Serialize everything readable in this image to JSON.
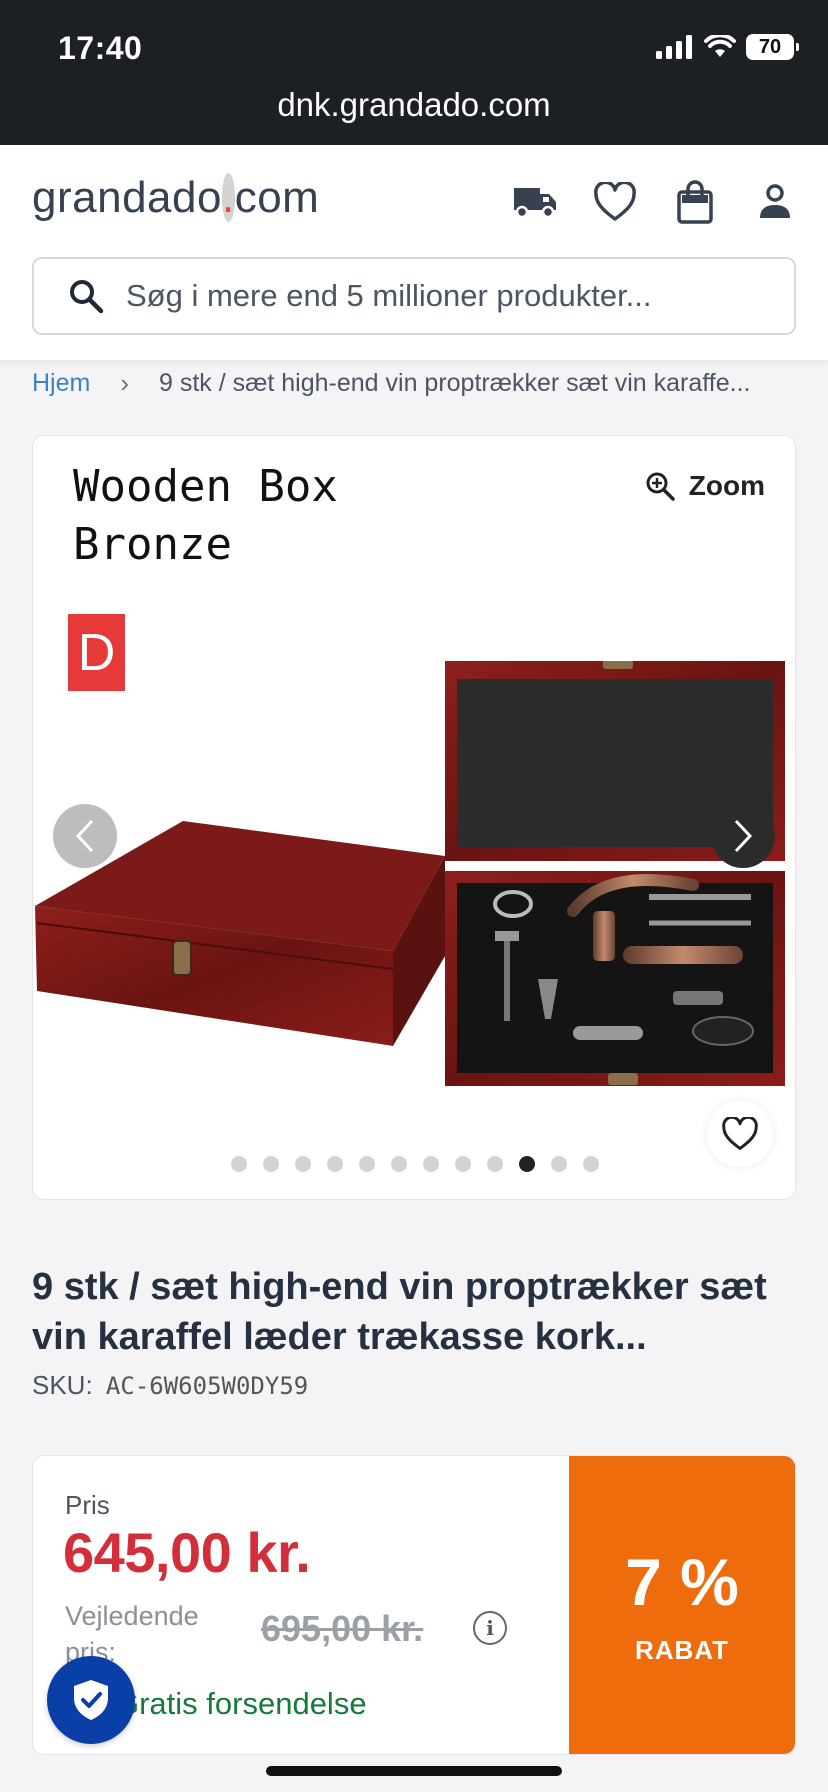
{
  "status_bar": {
    "time": "17:40",
    "battery": "70",
    "url": "dnk.grandado.com"
  },
  "header": {
    "logo_part1": "grandado",
    "logo_dot": ".",
    "logo_part2": "com",
    "icons": [
      "truck-icon",
      "heart-icon",
      "shopping-bag-icon",
      "user-icon"
    ],
    "search_placeholder": "Søg i mere end 5 millioner produkter..."
  },
  "breadcrumb": {
    "home": "Hjem",
    "current": "9 stk / sæt high-end vin proptrækker sæt vin karaffe..."
  },
  "gallery": {
    "image_caption_line1": "Wooden Box",
    "image_caption_line2": "Bronze",
    "badge": "D",
    "zoom_label": "Zoom",
    "dot_count": 12,
    "active_dot": 9
  },
  "product": {
    "title": "9 stk / sæt high-end vin proptrækker sæt vin karaffel læder trækasse kork...",
    "sku_label": "SKU:",
    "sku": "AC-6W605W0DY59"
  },
  "pricing": {
    "price_label": "Pris",
    "price": "645,00 kr.",
    "rrp_label": "Vejledende pris:",
    "rrp": "695,00 kr.",
    "info": "i",
    "shipping": "Gratis forsendelse",
    "discount": "7 %",
    "discount_label": "RABAT"
  },
  "colors": {
    "accent_orange": "#ee6c0b",
    "price_red": "#d32f3a",
    "link_blue": "#3b82c4",
    "shipping_green": "#177a3a"
  }
}
